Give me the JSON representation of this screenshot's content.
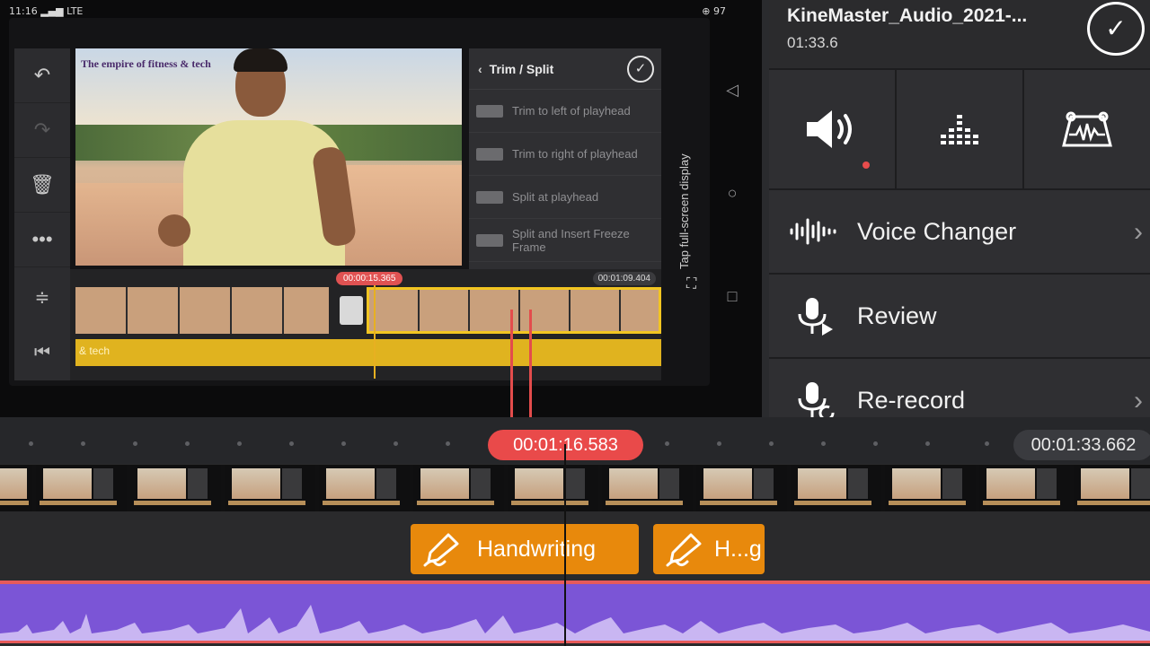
{
  "preview": {
    "status_time": "11:16",
    "status_icons": "LTE",
    "battery": "97",
    "video_title": "The empire of fitness & tech",
    "trim_panel": {
      "title": "Trim / Split",
      "items": [
        "Trim to left of playhead",
        "Trim to right of playhead",
        "Split at playhead",
        "Split and Insert Freeze Frame"
      ]
    },
    "timeline": {
      "time_a": "00:00:15.365",
      "time_b": "00:01:09.404",
      "text_track": "& tech"
    },
    "fullscreen_hint": "Tap full-screen display"
  },
  "right_panel": {
    "title": "KineMaster_Audio_2021-...",
    "duration": "01:33.6",
    "icons": [
      "volume-icon",
      "equalizer-icon",
      "audio-envelope-icon"
    ],
    "rows": [
      {
        "label": "Voice Changer",
        "icon": "voice-wave-icon",
        "chevron": true
      },
      {
        "label": "Review",
        "icon": "mic-play-icon",
        "chevron": false
      },
      {
        "label": "Re-record",
        "icon": "mic-rerecord-icon",
        "chevron": true
      }
    ]
  },
  "timeline": {
    "current_time": "00:01:16.583",
    "total_time": "00:01:33.662",
    "layers": [
      {
        "label": "Handwriting"
      },
      {
        "label": "H...g"
      }
    ],
    "accent_colors": {
      "playhead_badge": "#e94a4a",
      "handwriting_layer": "#e8890c",
      "audio_track": "#7b55d6"
    }
  }
}
